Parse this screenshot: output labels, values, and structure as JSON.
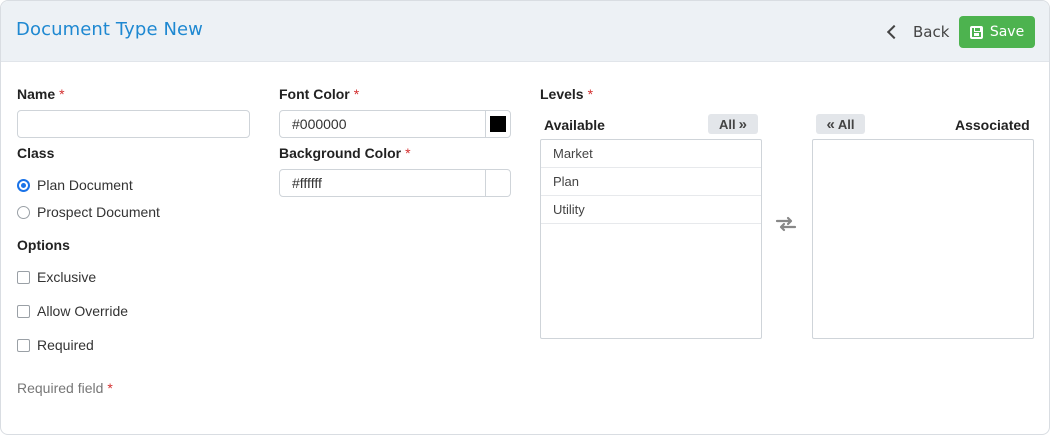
{
  "header": {
    "title": "Document Type New",
    "back_label": "Back",
    "save_label": "Save"
  },
  "name_field": {
    "label": "Name",
    "required_mark": "*",
    "value": ""
  },
  "class_field": {
    "label": "Class",
    "options": [
      {
        "label": "Plan Document",
        "selected": true
      },
      {
        "label": "Prospect Document",
        "selected": false
      }
    ]
  },
  "options_field": {
    "label": "Options",
    "items": [
      {
        "label": "Exclusive",
        "checked": false
      },
      {
        "label": "Allow Override",
        "checked": false
      },
      {
        "label": "Required",
        "checked": false
      }
    ]
  },
  "font_color": {
    "label": "Font Color",
    "required_mark": "*",
    "value": "#000000",
    "swatch": "#000000"
  },
  "background_color": {
    "label": "Background Color",
    "required_mark": "*",
    "value": "#ffffff",
    "swatch": "#ffffff"
  },
  "levels": {
    "label": "Levels",
    "required_mark": "*",
    "available_label": "Available",
    "associated_label": "Associated",
    "all_right_label": "All",
    "all_left_label": "All",
    "available_items": [
      "Market",
      "Plan",
      "Utility"
    ],
    "associated_items": []
  },
  "footer": {
    "note": "Required field",
    "required_mark": "*"
  },
  "colors": {
    "accent": "#1e88d1",
    "save": "#4db34f",
    "required": "#d32f2f",
    "radio_on": "#1a73e8"
  },
  "icons": {
    "back": "chevron-left-icon",
    "save": "floppy-disk-icon",
    "swap": "swap-arrows-icon",
    "all_right": "double-chevron-right-icon",
    "all_left": "double-chevron-left-icon"
  }
}
